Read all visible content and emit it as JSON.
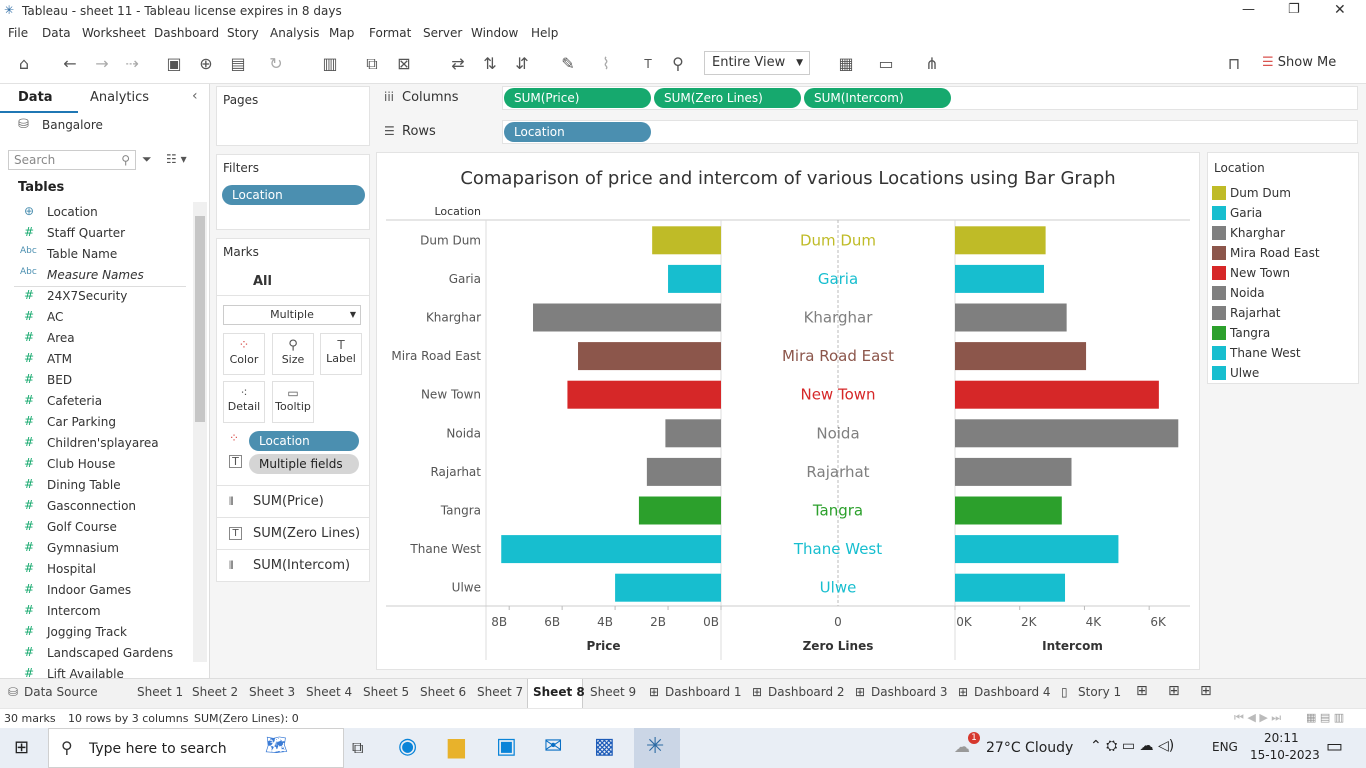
{
  "window": {
    "title": "Tableau - sheet 11 - Tableau license expires in 8 days",
    "min": "—",
    "max": "❐",
    "close": "✕"
  },
  "menu": [
    "File",
    "Data",
    "Worksheet",
    "Dashboard",
    "Story",
    "Analysis",
    "Map",
    "Format",
    "Server",
    "Window",
    "Help"
  ],
  "toolbar": {
    "fit": "Entire View",
    "show_me": "Show Me"
  },
  "left": {
    "tab_data": "Data",
    "tab_analytics": "Analytics",
    "datasource": "Bangalore",
    "search_placeholder": "Search",
    "tables_label": "Tables",
    "fields": [
      {
        "type": "globe",
        "name": "Location"
      },
      {
        "type": "#",
        "name": "Staff Quarter"
      },
      {
        "type": "Abc",
        "name": "Table Name"
      },
      {
        "type": "Abc",
        "name": "Measure Names"
      },
      {
        "type": "#",
        "name": "24X7Security"
      },
      {
        "type": "#",
        "name": "AC"
      },
      {
        "type": "#",
        "name": "Area"
      },
      {
        "type": "#",
        "name": "ATM"
      },
      {
        "type": "#",
        "name": "BED"
      },
      {
        "type": "#",
        "name": "Cafeteria"
      },
      {
        "type": "#",
        "name": "Car Parking"
      },
      {
        "type": "#",
        "name": "Children'splayarea"
      },
      {
        "type": "#",
        "name": "Club House"
      },
      {
        "type": "#",
        "name": "Dining Table"
      },
      {
        "type": "#",
        "name": "Gasconnection"
      },
      {
        "type": "#",
        "name": "Golf Course"
      },
      {
        "type": "#",
        "name": "Gymnasium"
      },
      {
        "type": "#",
        "name": "Hospital"
      },
      {
        "type": "#",
        "name": "Indoor Games"
      },
      {
        "type": "#",
        "name": "Intercom"
      },
      {
        "type": "#",
        "name": "Jogging Track"
      },
      {
        "type": "#",
        "name": "Landscaped Gardens"
      },
      {
        "type": "#",
        "name": "Lift Available"
      }
    ]
  },
  "pages": {
    "label": "Pages"
  },
  "filters": {
    "label": "Filters",
    "pill": "Location"
  },
  "marks": {
    "label": "Marks",
    "all": "All",
    "type": "Multiple",
    "color": "Color",
    "size": "Size",
    "label_btn": "Label",
    "detail": "Detail",
    "tooltip": "Tooltip",
    "pill_location": "Location",
    "pill_multiple": "Multiple fields",
    "m1": "SUM(Price)",
    "m2": "SUM(Zero Lines)",
    "m3": "SUM(Intercom)"
  },
  "shelves": {
    "columns_label": "Columns",
    "rows_label": "Rows",
    "col_pills": [
      "SUM(Price)",
      "SUM(Zero Lines)",
      "SUM(Intercom)"
    ],
    "row_pill": "Location"
  },
  "chart_data": {
    "type": "bar",
    "title": "Comaparison of price and intercom of various Locations using Bar Graph",
    "row_header": "Location",
    "categories": [
      "Dum Dum",
      "Garia",
      "Kharghar",
      "Mira Road East",
      "New Town",
      "Noida",
      "Rajarhat",
      "Tangra",
      "Thane West",
      "Ulwe"
    ],
    "colors": [
      "#bfbb27",
      "#17becf",
      "#7f7f7f",
      "#8c564b",
      "#d62728",
      "#7f7f7f",
      "#7f7f7f",
      "#2ca02c",
      "#17becf",
      "#17becf"
    ],
    "series": [
      {
        "name": "Price",
        "values": [
          2.6,
          2.0,
          7.1,
          5.4,
          5.8,
          2.1,
          2.8,
          3.1,
          8.3,
          4.0
        ],
        "ticks": [
          "8B",
          "6B",
          "4B",
          "2B",
          "0B"
        ],
        "xlim": [
          0,
          8.8
        ],
        "reversed": true
      },
      {
        "name": "Zero Lines",
        "tick": "0"
      },
      {
        "name": "Intercom",
        "values": [
          2.8,
          2.75,
          3.45,
          4.05,
          6.3,
          6.9,
          3.6,
          3.3,
          5.05,
          3.4
        ],
        "ticks": [
          "0K",
          "2K",
          "4K",
          "6K"
        ],
        "xlim": [
          0,
          7.2
        ]
      }
    ]
  },
  "legend": {
    "title": "Location"
  },
  "tabs": [
    "Data Source",
    "Sheet 1",
    "Sheet 2",
    "Sheet 3",
    "Sheet 4",
    "Sheet 5",
    "Sheet 6",
    "Sheet 7",
    "Sheet 8",
    "Sheet 9",
    "Dashboard 1",
    "Dashboard 2",
    "Dashboard 3",
    "Dashboard 4",
    "Story 1"
  ],
  "status": {
    "marks": "30 marks",
    "rows": "10 rows by 3 columns",
    "sum": "SUM(Zero Lines): 0"
  },
  "taskbar": {
    "search": "Type here to search",
    "weather": "27°C  Cloudy",
    "lang": "ENG",
    "time": "20:11",
    "date": "15-10-2023",
    "badge": "1"
  }
}
